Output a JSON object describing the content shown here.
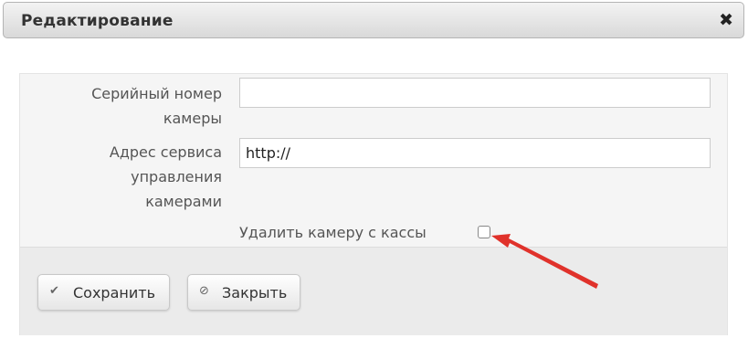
{
  "dialog": {
    "title": "Редактирование",
    "close_icon": "close-icon"
  },
  "form": {
    "serial_label_line1": "Серийный номер",
    "serial_label_line2": "камеры",
    "serial_value": "",
    "address_label_line1": "Адрес сервиса",
    "address_label_line2": "управления",
    "address_label_line3": "камерами",
    "address_value": "http://",
    "remove_camera_label": "Удалить камеру с кассы",
    "remove_camera_checked": false
  },
  "buttons": {
    "save_label": "Сохранить",
    "save_icon": "check-icon",
    "close_label": "Закрыть",
    "close_icon": "ban-icon"
  },
  "annotation": {
    "arrow_color": "#e0322b"
  }
}
